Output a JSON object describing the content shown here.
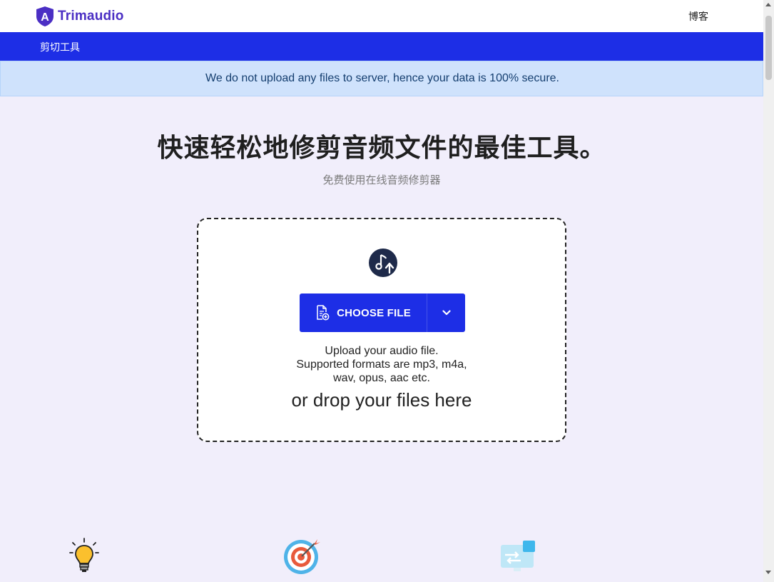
{
  "header": {
    "logo_letter": "A",
    "brand_name": "Trimaudio",
    "blog_link": "博客"
  },
  "nav": {
    "items": [
      {
        "label": "剪切工具"
      }
    ]
  },
  "notice": {
    "text": "We do not upload any files to server, hence your data is 100% secure."
  },
  "hero": {
    "title": "快速轻松地修剪音频文件的最佳工具。",
    "subtitle": "免费使用在线音频修剪器"
  },
  "uploader": {
    "choose_file_label": "CHOOSE FILE",
    "description_lines": [
      "Upload your audio file.",
      "Supported formats are mp3, m4a,",
      "wav, opus, aac etc."
    ],
    "drop_text": "or drop your files here"
  },
  "features": {
    "icons": [
      "lightbulb-icon",
      "target-icon",
      "computer-transfer-icon"
    ]
  },
  "colors": {
    "brand_purple": "#4b2fc4",
    "nav_blue": "#1d2ee6",
    "notice_bg": "#cfe2fc",
    "page_bg": "#f1eefb"
  }
}
